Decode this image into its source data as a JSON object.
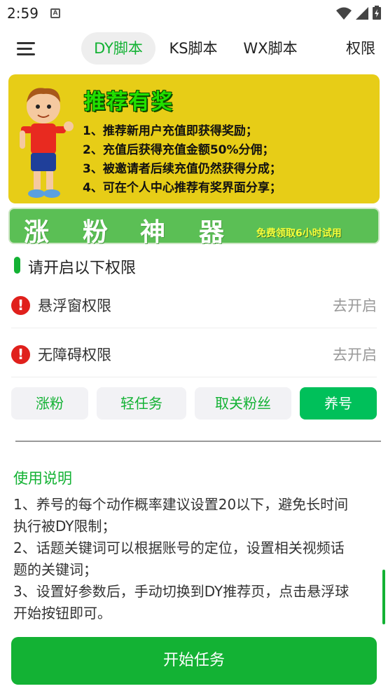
{
  "status_bar": {
    "time": "2:59"
  },
  "nav": {
    "tabs": [
      {
        "label": "DY脚本"
      },
      {
        "label": "KS脚本"
      },
      {
        "label": "WX脚本"
      },
      {
        "label": "权限"
      }
    ]
  },
  "banner": {
    "title": "推荐有奖",
    "lines": [
      "1、推荐新用户充值即获得奖励；",
      "2、充值后获得充值金额50%分佣；",
      "3、被邀请者后续充值仍然获得分成；",
      "4、可在个人中心推荐有奖界面分享；"
    ]
  },
  "promo": {
    "chars": [
      "涨",
      "粉",
      "神",
      "器"
    ],
    "subtitle": "免费领取6小时试用"
  },
  "permissions": {
    "header": "请开启以下权限",
    "items": [
      {
        "label": "悬浮窗权限",
        "action": "去开启"
      },
      {
        "label": "无障碍权限",
        "action": "去开启"
      }
    ]
  },
  "modes": [
    {
      "label": "涨粉"
    },
    {
      "label": "轻任务"
    },
    {
      "label": "取关粉丝"
    },
    {
      "label": "养号"
    }
  ],
  "instructions": {
    "title": "使用说明",
    "lines": [
      "1、养号的每个动作概率建议设置20以下，避免长时间",
      "执行被DY限制；",
      "2、话题关键词可以根据账号的定位，设置相关视频话",
      "题的关键词；",
      "3、设置好参数后，手动切换到DY推荐页，点击悬浮球",
      "开始按钮即可。"
    ]
  },
  "start_button": {
    "label": "开始任务"
  },
  "colors": {
    "accent": "#13b234",
    "banner_bg": "#e7cd17",
    "promo_bg": "#5bbf55",
    "warn": "#e0201c"
  }
}
